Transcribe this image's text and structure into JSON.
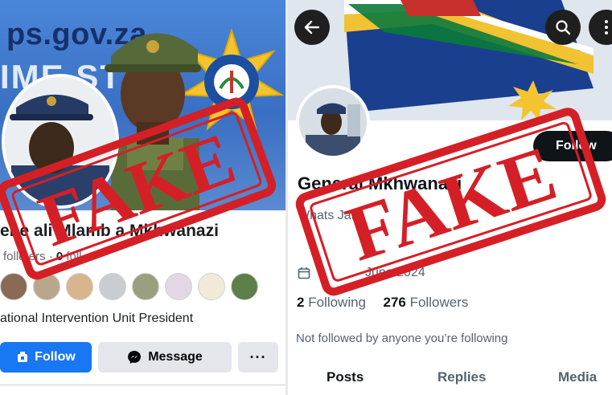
{
  "facebook": {
    "cover": {
      "url_text": "ps.gov.za",
      "banner_text": "IME ST"
    },
    "profile_name": "ene ali Mlamb a Mkhwanazi",
    "counts": {
      "followers_label": "follo ers",
      "following_value": "0",
      "following_label": "foll"
    },
    "bio": "ational Intervention Unit President",
    "buttons": {
      "follow": "Follow",
      "message": "Message",
      "more": "···"
    },
    "colors": {
      "primary": "#1877f2",
      "secondary": "#e4e6eb"
    }
  },
  "x_profile": {
    "display_name": "General Mkhwanazi",
    "handle": "Whats Jan",
    "joined": "June 2024",
    "following_count": "2",
    "following_label": "Following",
    "followers_count": "276",
    "followers_label": "Followers",
    "not_followed_note": "Not followed by anyone you’re following",
    "follow_button": "Follow",
    "tabs": [
      {
        "label": "Posts",
        "active": true
      },
      {
        "label": "Replies",
        "active": false
      },
      {
        "label": "Media",
        "active": false
      }
    ],
    "icons": {
      "back": "back-arrow-icon",
      "search": "search-icon",
      "more": "more-vertical-icon",
      "calendar": "calendar-icon"
    }
  },
  "stamps": {
    "left": "FAKE",
    "right": "FAKE",
    "color": "#d51f26"
  }
}
